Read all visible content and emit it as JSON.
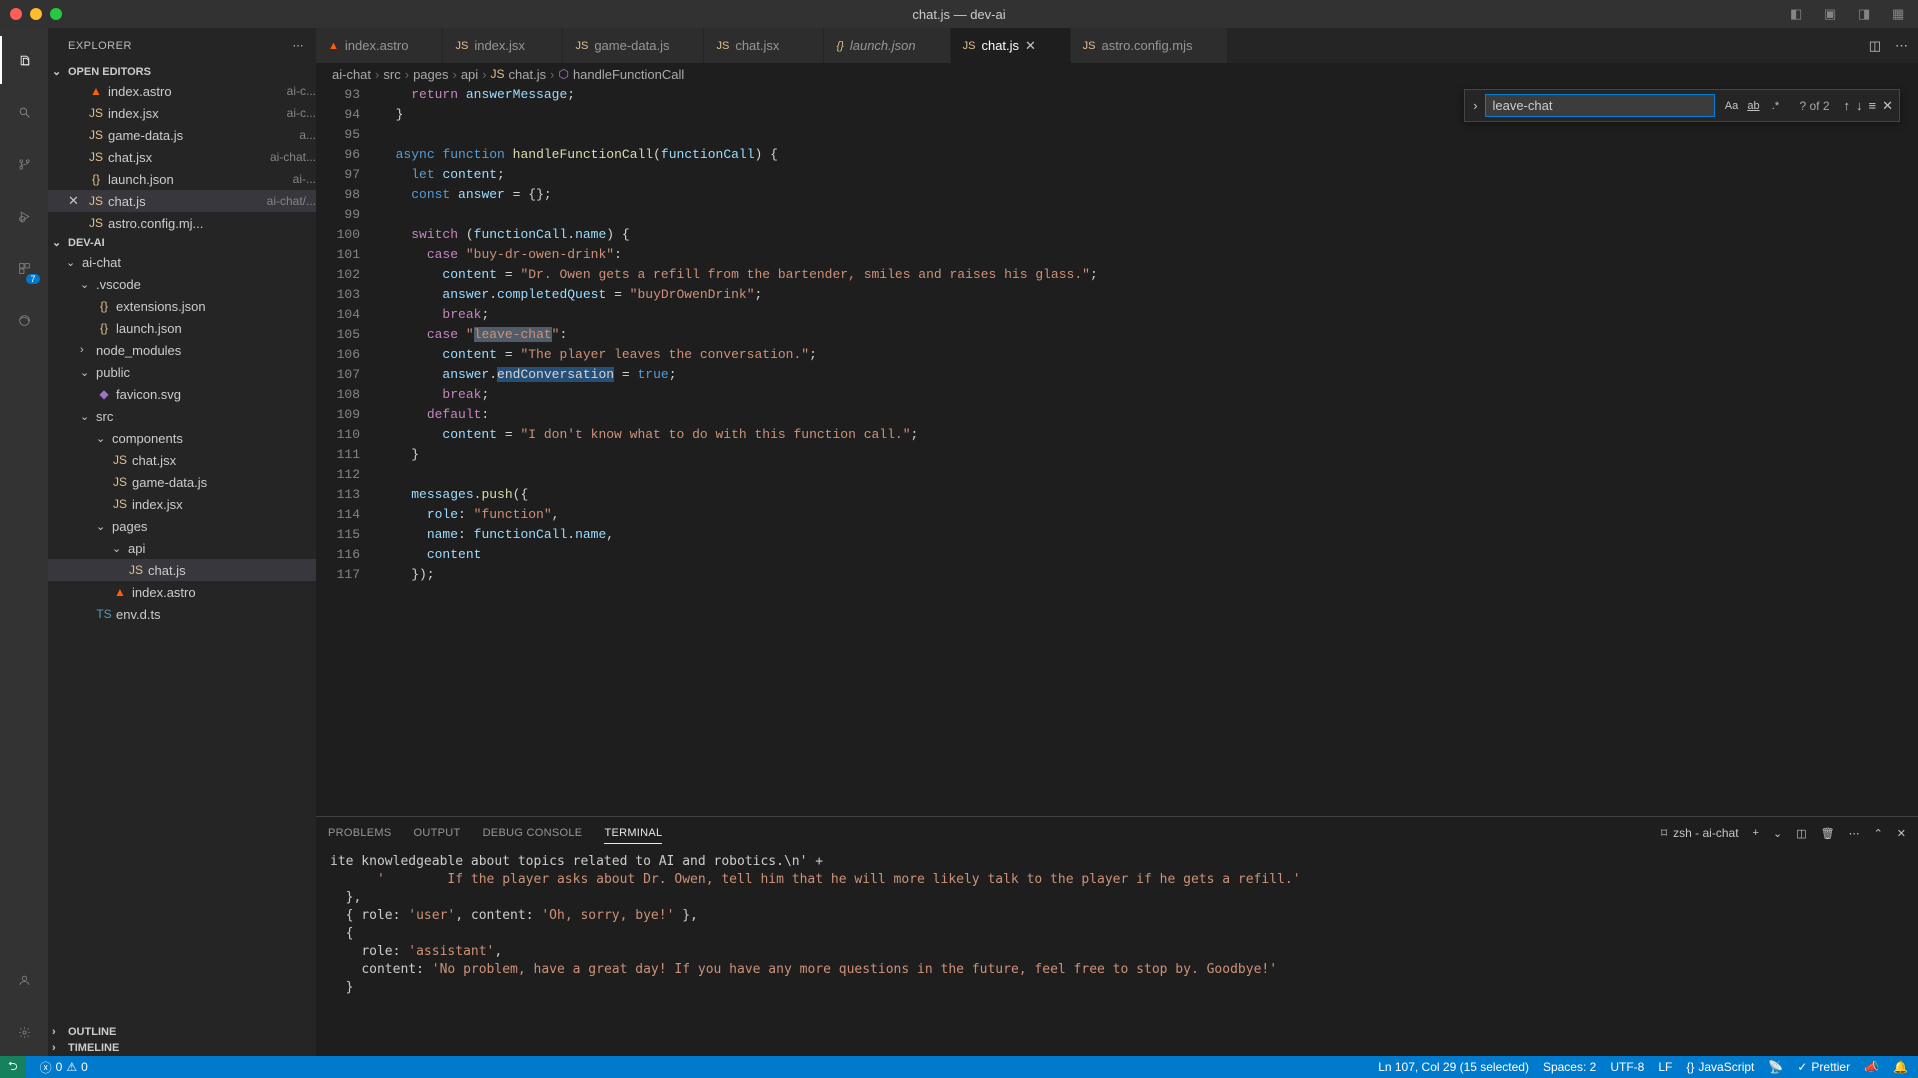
{
  "window": {
    "title": "chat.js — dev-ai"
  },
  "explorer": {
    "title": "EXPLORER",
    "sections": {
      "open_editors": "OPEN EDITORS",
      "project": "DEV-AI",
      "outline": "OUTLINE",
      "timeline": "TIMELINE"
    },
    "open_editors": [
      {
        "name": "index.astro",
        "desc": "ai-c...",
        "icon": "astro"
      },
      {
        "name": "index.jsx",
        "desc": "ai-c...",
        "icon": "js"
      },
      {
        "name": "game-data.js",
        "desc": "a...",
        "icon": "js"
      },
      {
        "name": "chat.jsx",
        "desc": "ai-chat...",
        "icon": "js"
      },
      {
        "name": "launch.json",
        "desc": "ai-...",
        "icon": "json"
      },
      {
        "name": "chat.js",
        "desc": "ai-chat/...",
        "icon": "js",
        "active": true
      },
      {
        "name": "astro.config.mj...",
        "desc": "",
        "icon": "js"
      }
    ],
    "tree": {
      "ai_chat": "ai-chat",
      "vscode": ".vscode",
      "extensions_json": "extensions.json",
      "launch_json": "launch.json",
      "node_modules": "node_modules",
      "public": "public",
      "favicon": "favicon.svg",
      "src": "src",
      "components": "components",
      "chat_jsx": "chat.jsx",
      "game_data_js": "game-data.js",
      "index_jsx": "index.jsx",
      "pages": "pages",
      "api": "api",
      "chat_js": "chat.js",
      "index_astro": "index.astro",
      "env_dts": "env.d.ts"
    }
  },
  "tabs": [
    {
      "name": "index.astro",
      "icon": "astro"
    },
    {
      "name": "index.jsx",
      "icon": "js"
    },
    {
      "name": "game-data.js",
      "icon": "js"
    },
    {
      "name": "chat.jsx",
      "icon": "js"
    },
    {
      "name": "launch.json",
      "icon": "json",
      "italic": true
    },
    {
      "name": "chat.js",
      "icon": "js",
      "active": true
    },
    {
      "name": "astro.config.mjs",
      "icon": "js"
    }
  ],
  "breadcrumbs": [
    "ai-chat",
    "src",
    "pages",
    "api",
    "chat.js",
    "handleFunctionCall"
  ],
  "find": {
    "value": "leave-chat",
    "results": "? of 2"
  },
  "code_lines": [
    {
      "n": 93,
      "html": "    <span class='kw'>return</span> <span class='prop'>answerMessage</span>;"
    },
    {
      "n": 94,
      "html": "  }"
    },
    {
      "n": 95,
      "html": ""
    },
    {
      "n": 96,
      "html": "  <span class='kw2'>async</span> <span class='kw2'>function</span> <span class='fn'>handleFunctionCall</span>(<span class='prop'>functionCall</span>) {"
    },
    {
      "n": 97,
      "html": "    <span class='kw2'>let</span> <span class='prop'>content</span>;"
    },
    {
      "n": 98,
      "html": "    <span class='kw2'>const</span> <span class='prop'>answer</span> = {};"
    },
    {
      "n": 99,
      "html": ""
    },
    {
      "n": 100,
      "html": "    <span class='kw'>switch</span> (<span class='prop'>functionCall</span>.<span class='prop'>name</span>) {"
    },
    {
      "n": 101,
      "html": "      <span class='kw'>case</span> <span class='str'>\"buy-dr-owen-drink\"</span>:"
    },
    {
      "n": 102,
      "html": "        <span class='prop'>content</span> = <span class='str'>\"Dr. Owen gets a refill from the bartender, smiles and raises his glass.\"</span>;"
    },
    {
      "n": 103,
      "html": "        <span class='prop'>answer</span>.<span class='prop'>completedQuest</span> = <span class='str'>\"buyDrOwenDrink\"</span>;"
    },
    {
      "n": 104,
      "html": "        <span class='kw'>break</span>;"
    },
    {
      "n": 105,
      "html": "      <span class='kw'>case</span> <span class='str'>\"<span class='hl'>leave-chat</span>\"</span>:"
    },
    {
      "n": 106,
      "html": "        <span class='prop'>content</span> = <span class='str'>\"The player leaves the conversation.\"</span>;"
    },
    {
      "n": 107,
      "html": "        <span class='prop'>answer</span>.<span class='sel'>endConversation</span> = <span class='kw2'>true</span>;",
      "bulb": true
    },
    {
      "n": 108,
      "html": "        <span class='kw'>break</span>;"
    },
    {
      "n": 109,
      "html": "      <span class='kw'>default</span>:"
    },
    {
      "n": 110,
      "html": "        <span class='prop'>content</span> = <span class='str'>\"I don't know what to do with this function call.\"</span>;"
    },
    {
      "n": 111,
      "html": "    }"
    },
    {
      "n": 112,
      "html": ""
    },
    {
      "n": 113,
      "html": "    <span class='prop'>messages</span>.<span class='fn'>push</span>({"
    },
    {
      "n": 114,
      "html": "      <span class='prop'>role</span>: <span class='str'>\"function\"</span>,"
    },
    {
      "n": 115,
      "html": "      <span class='prop'>name</span>: <span class='prop'>functionCall</span>.<span class='prop'>name</span>,"
    },
    {
      "n": 116,
      "html": "      <span class='prop'>content</span>"
    },
    {
      "n": 117,
      "html": "    });"
    }
  ],
  "panel": {
    "tabs": {
      "problems": "PROBLEMS",
      "output": "OUTPUT",
      "debug": "DEBUG CONSOLE",
      "terminal": "TERMINAL"
    },
    "terminal_label": "zsh - ai-chat",
    "terminal_lines": [
      "ite knowledgeable about topics related to AI and robotics.\\n' +",
      "      '        If the player asks about Dr. Owen, tell him that he will more likely talk to the player if he gets a refill.'",
      "  },",
      "  { role: 'user', content: 'Oh, sorry, bye!' },",
      "  {",
      "    role: 'assistant',",
      "    content: 'No problem, have a great day! If you have any more questions in the future, feel free to stop by. Goodbye!'",
      "  }"
    ]
  },
  "status": {
    "remote_badge": "✕",
    "errors": "0",
    "warnings": "0",
    "cursor": "Ln 107, Col 29 (15 selected)",
    "spaces": "Spaces: 2",
    "encoding": "UTF-8",
    "eol": "LF",
    "lang": "JavaScript",
    "prettier": "Prettier"
  },
  "activity_badge": "7"
}
